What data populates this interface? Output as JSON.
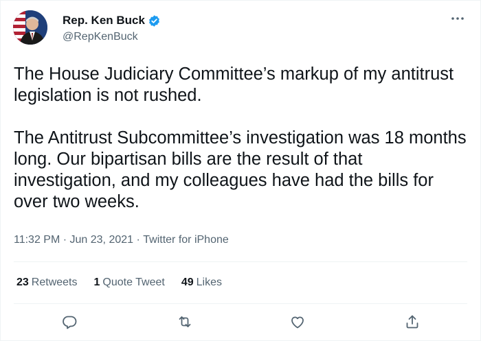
{
  "tweet": {
    "author_name": "Rep. Ken Buck",
    "author_handle": "@RepKenBuck",
    "text": "The House Judiciary Committee’s markup of my antitrust legislation is not rushed.\n\nThe Antitrust Subcommittee’s investigation was 18 months long. Our bipartisan bills are the result of that investigation, and my colleagues have had the bills for over two weeks.",
    "time": "11:32 PM",
    "date": "Jun 23, 2021",
    "source": "Twitter for iPhone",
    "separator": " · "
  },
  "stats": {
    "retweets_count": "23",
    "retweets_label": "Retweets",
    "quotes_count": "1",
    "quotes_label": "Quote Tweet",
    "likes_count": "49",
    "likes_label": "Likes"
  },
  "icons": {
    "verified": "verified-badge-icon",
    "more": "more-options-icon",
    "reply": "reply-icon",
    "retweet": "retweet-icon",
    "like": "heart-icon",
    "share": "share-icon"
  },
  "colors": {
    "accent": "#1d9bf0",
    "text": "#0f1419",
    "muted": "#536471"
  }
}
